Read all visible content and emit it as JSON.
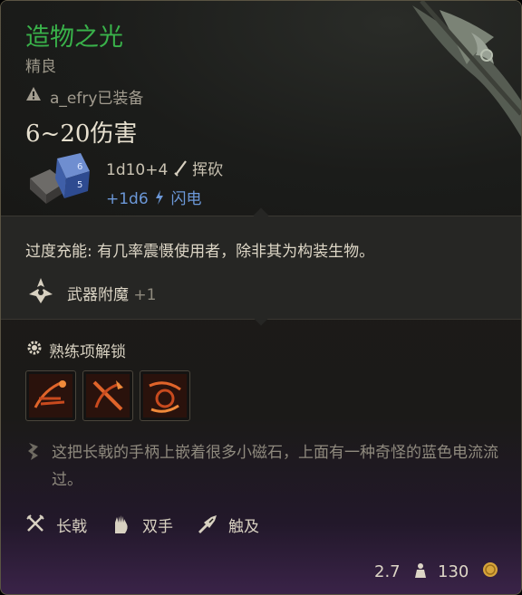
{
  "item": {
    "name": "造物之光",
    "rarity": "精良",
    "equipped_by": "a_efry已装备",
    "damage_total": "6~20伤害",
    "damage_primary": "1d10+4",
    "damage_primary_type": "挥砍",
    "damage_bonus": "+1d6",
    "damage_bonus_type": "闪电",
    "rarity_color": "#39b24a"
  },
  "effects": {
    "charge_text": "过度充能: 有几率震慑使用者，除非其为构装生物。",
    "enchant_label": "武器附魔",
    "enchant_value": "+1"
  },
  "proficiency": {
    "label": "熟练项解锁",
    "actions": [
      {
        "icon": "flourish-icon"
      },
      {
        "icon": "cleave-icon"
      },
      {
        "icon": "rush-icon"
      }
    ]
  },
  "description": "这把长戟的手柄上嵌着很多小磁石，上面有一种奇怪的蓝色电流流过。",
  "properties": [
    {
      "label": "长戟",
      "icon": "halberd-icon"
    },
    {
      "label": "双手",
      "icon": "two-handed-icon"
    },
    {
      "label": "触及",
      "icon": "reach-icon"
    }
  ],
  "footer": {
    "weight": "2.7",
    "price": "130"
  }
}
